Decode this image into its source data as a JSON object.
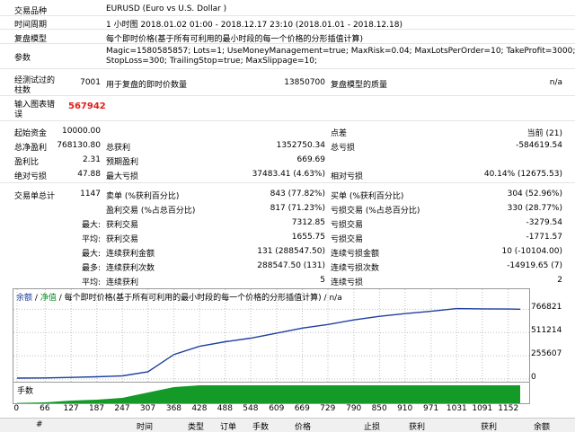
{
  "info": {
    "symbol_label": "交易品种",
    "symbol_value": "EURUSD (Euro vs U.S. Dollar )",
    "period_label": "时间周期",
    "period_value": "1 小时图 2018.01.02 01:00 - 2018.12.17 23:10 (2018.01.01 - 2018.12.18)",
    "model_label": "复盘模型",
    "model_value": "每个即时价格(基于所有可利用的最小时段的每一个价格的分形插值计算)",
    "params_label": "参数",
    "params_line1": "Magic=1580585857; Lots=1; UseMoneyManagement=true; MaxRisk=0.04; MaxLotsPerOrder=10; TakeProfit=3000;",
    "params_line2": "StopLoss=300; TrailingStop=true; MaxSlippage=10;",
    "bars_label_1": "经测试过的",
    "bars_label_2": "柱数",
    "bars_value": "7001",
    "ticks_label": "用于复盘的即时价数量",
    "ticks_value": "13850700",
    "quality_label": "复盘模型的质量",
    "quality_value": "n/a",
    "errors_label_1": "输入图表错",
    "errors_label_2": "误",
    "errors_value": "567942"
  },
  "stats": {
    "deposit_label": "起始资金",
    "deposit_value": "10000.00",
    "spread_label": "点差",
    "spread_value": "当前 (21)",
    "net_profit_label": "总净盈利",
    "net_profit_value": "768130.80",
    "gross_profit_label": "总获利",
    "gross_profit_value": "1352750.34",
    "gross_loss_label": "总亏损",
    "gross_loss_value": "-584619.54",
    "profit_factor_label": "盈利比",
    "profit_factor_value": "2.31",
    "expected_payoff_label": "预期盈利",
    "expected_payoff_value": "669.69",
    "abs_drawdown_label": "绝对亏损",
    "abs_drawdown_value": "47.88",
    "max_drawdown_label": "最大亏损",
    "max_drawdown_value": "37483.41 (4.63%)",
    "rel_drawdown_label": "相对亏损",
    "rel_drawdown_value": "40.14% (12675.53)",
    "total_trades_label": "交易单总计",
    "total_trades_value": "1147",
    "short_label": "卖单 (%获利百分比)",
    "short_value": "843 (77.82%)",
    "long_label": "买单 (%获利百分比)",
    "long_value": "304 (52.96%)",
    "profit_trades_label": "盈利交易 (%占总百分比)",
    "profit_trades_value": "817 (71.23%)",
    "loss_trades_label": "亏损交易 (%占总百分比)",
    "loss_trades_value": "330 (28.77%)",
    "largest_label": "最大:",
    "largest_profit_label": "获利交易",
    "largest_profit_value": "7312.85",
    "largest_loss_label": "亏损交易",
    "largest_loss_value": "-3279.54",
    "average_label": "平均:",
    "avg_profit_label": "获利交易",
    "avg_profit_value": "1655.75",
    "avg_loss_label": "亏损交易",
    "avg_loss_value": "-1771.57",
    "max_label": "最大:",
    "max_cons_wins_label": "连续获利金额",
    "max_cons_wins_value": "131 (288547.50)",
    "max_cons_losses_label": "连续亏损金额",
    "max_cons_losses_value": "10 (-10104.00)",
    "maximal_label": "最多:",
    "maximal_cons_profit_label": "连续获利次数",
    "maximal_cons_profit_value": "288547.50 (131)",
    "maximal_cons_loss_label": "连续亏损次数",
    "maximal_cons_loss_value": "-14919.65 (7)",
    "avg2_label": "平均:",
    "avg_cons_wins_label": "连续获利",
    "avg_cons_wins_value": "5",
    "avg_cons_losses_label": "连续亏损",
    "avg_cons_losses_value": "2"
  },
  "chart_header": {
    "balance": "余额",
    "equity": "净值",
    "description": "每个即时价格(基于所有可利用的最小时段的每一个价格的分形插值计算)",
    "sep1": "/",
    "sep2": "/",
    "sep3": "/",
    "na": "n/a"
  },
  "volume_label": "手数",
  "table_headers": [
    "#",
    "时间",
    "类型",
    "订单",
    "手数",
    "价格",
    "止损",
    "获利",
    "获利",
    "余额"
  ],
  "colors": {
    "balance_line": "#1f3f9f",
    "volume_fill": "#139a27",
    "label_blue": "#1a3b9e",
    "label_green": "#0a8a22"
  },
  "chart_data": {
    "type": "line",
    "series": [
      {
        "name": "余额",
        "x": [
          0,
          66,
          127,
          187,
          247,
          307,
          368,
          428,
          488,
          548,
          609,
          669,
          729,
          790,
          850,
          910,
          971,
          1031,
          1091,
          1152,
          1180
        ],
        "y": [
          10000,
          12000,
          18000,
          25000,
          35000,
          80000,
          270000,
          360000,
          410000,
          450000,
          505000,
          560000,
          600000,
          650000,
          690000,
          720000,
          745000,
          775000,
          772000,
          770000,
          768131
        ]
      }
    ],
    "x_ticks": [
      "0",
      "66",
      "127",
      "187",
      "247",
      "307",
      "368",
      "428",
      "488",
      "548",
      "609",
      "669",
      "729",
      "790",
      "850",
      "910",
      "971",
      "1031",
      "1091",
      "1152"
    ],
    "y_ticks": [
      "766821",
      "511214",
      "255607",
      "0"
    ],
    "y_tick_values": [
      766821,
      511214,
      255607,
      0
    ],
    "xlim": [
      0,
      1180
    ],
    "ylim": [
      0,
      850000
    ],
    "grid": true,
    "volume_series": {
      "name": "手数",
      "x": [
        0,
        66,
        127,
        187,
        247,
        307,
        368,
        428,
        488,
        548,
        609,
        669,
        729,
        790,
        850,
        910,
        971,
        1031,
        1091,
        1152,
        1180
      ],
      "y": [
        0.2,
        0.5,
        1.5,
        2,
        3,
        6,
        9,
        10,
        10,
        10,
        10,
        10,
        10,
        10,
        10,
        10,
        10,
        10,
        10,
        10,
        10
      ]
    }
  }
}
